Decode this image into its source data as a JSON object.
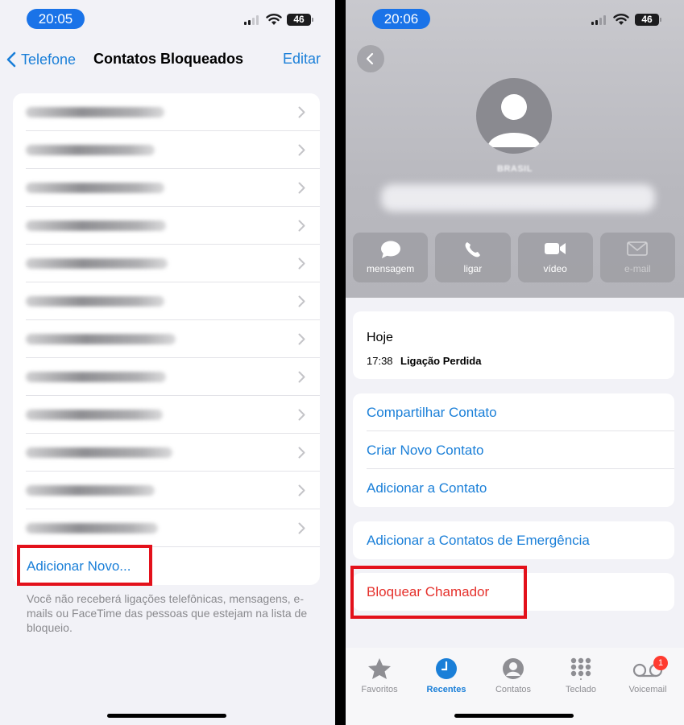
{
  "left": {
    "status": {
      "time": "20:05",
      "battery": "46"
    },
    "nav": {
      "back_label": "Telefone",
      "title": "Contatos Bloqueados",
      "edit_label": "Editar"
    },
    "blocked_rows": 12,
    "add_new_label": "Adicionar Novo...",
    "footer_note": "Você não receberá ligações telefônicas, mensagens, e-mails ou FaceTime das pessoas que estejam na lista de bloqueio."
  },
  "right": {
    "status": {
      "time": "20:06",
      "battery": "46"
    },
    "contact": {
      "country": "BRASIL"
    },
    "actions": [
      {
        "label": "mensagem",
        "icon": "message-icon",
        "enabled": true
      },
      {
        "label": "ligar",
        "icon": "phone-icon",
        "enabled": true
      },
      {
        "label": "vídeo",
        "icon": "video-icon",
        "enabled": true
      },
      {
        "label": "e-mail",
        "icon": "mail-icon",
        "enabled": false
      }
    ],
    "recent": {
      "day": "Hoje",
      "time": "17:38",
      "type": "Ligação Perdida"
    },
    "options": [
      "Compartilhar Contato",
      "Criar Novo Contato",
      "Adicionar a Contato"
    ],
    "emergency_label": "Adicionar a Contatos de Emergência",
    "block_label": "Bloquear Chamador",
    "tabs": [
      {
        "label": "Favoritos",
        "icon": "star-icon",
        "active": false
      },
      {
        "label": "Recentes",
        "icon": "clock-icon",
        "active": true
      },
      {
        "label": "Contatos",
        "icon": "person-icon",
        "active": false
      },
      {
        "label": "Teclado",
        "icon": "keypad-icon",
        "active": false
      },
      {
        "label": "Voicemail",
        "icon": "voicemail-icon",
        "active": false,
        "badge": "1"
      }
    ]
  },
  "colors": {
    "accent": "#1a7fd8",
    "destructive": "#e5312c",
    "highlight_box": "#e3111b",
    "time_pill": "#1a73e8"
  }
}
